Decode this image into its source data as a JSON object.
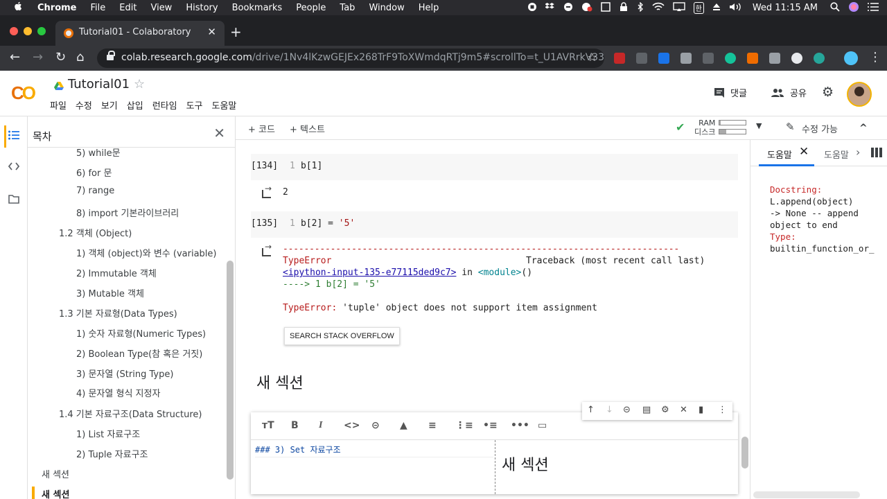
{
  "menubar": {
    "apple": "",
    "app": "Chrome",
    "items": [
      "File",
      "Edit",
      "View",
      "History",
      "Bookmarks",
      "People",
      "Tab",
      "Window",
      "Help"
    ],
    "ime": "한",
    "clock": "Wed 11:15 AM"
  },
  "browser": {
    "tab_title": "Tutorial01 - Colaboratory",
    "tab_close": "✕",
    "new_tab": "+",
    "url_host": "colab.research.google.com",
    "url_path": "/drive/1Nv4lKzwGEJEx268TrF9ToXWmdqRTj9m5#scrollTo=t_U1AVRrkV33",
    "back": "←",
    "forward": "→",
    "reload": "↻",
    "home": "⌂",
    "bookmark_star": "☆"
  },
  "colab": {
    "logo": "CO",
    "title": "Tutorial01",
    "title_star": "☆",
    "menus": [
      "파일",
      "수정",
      "보기",
      "삽입",
      "런타임",
      "도구",
      "도움말"
    ],
    "comment_label": "댓글",
    "share_label": "공유",
    "settings_glyph": "⚙"
  },
  "toc": {
    "header": "목차",
    "close": "✕",
    "items": [
      "5) while문",
      "6) for 문",
      "7) range",
      "8) import 기본라이브러리",
      "1.2 객체 (Object)",
      "1) 객체 (object)와 변수 (variable)",
      "2) Immutable 객체",
      "3) Mutable 객체",
      "1.3 기본 자료형(Data Types)",
      "1) 숫자 자료형(Numeric Types)",
      "2) Boolean Type(참 혹은 거짓)",
      "3) 문자열 (String Type)",
      "4) 문자열 형식 지정자",
      "1.4 기본 자료구조(Data Structure)",
      "1) List 자료구조",
      "2) Tuple 자료구조",
      "새 섹션",
      "새 섹션"
    ]
  },
  "notebook_toolbar": {
    "add_code": "+ 코드",
    "add_text": "+ 텍스트",
    "ram_label": "RAM",
    "disk_label": "디스크",
    "ram_usage": 0.05,
    "disk_usage": 0.25,
    "edit_mode": "수정 가능",
    "collapse": "^"
  },
  "cells": {
    "c134": {
      "prompt": "[134]",
      "line": "1",
      "code": "b[1]",
      "output": "2"
    },
    "c135": {
      "prompt": "[135]",
      "line": "1",
      "code_pre": "b[2] = ",
      "code_str": "'5'",
      "error_rule": "---------------------------------------------------------------------------",
      "error_type": "TypeError",
      "error_trace_label": "Traceback (most recent call last)",
      "error_link": "<ipython-input-135-e77115ded9c7>",
      "error_in": " in ",
      "error_module": "<module>",
      "error_paren": "()",
      "error_arrow": "----> 1 b[2] = '5'",
      "error_msg_type": "TypeError:",
      "error_msg": " 'tuple' object does not support item assignment",
      "so_button": "SEARCH STACK OVERFLOW"
    },
    "section_heading": "새 섹션",
    "text_cell_source": "### 3) Set 자료구조",
    "text_cell_preview": "새 섹션"
  },
  "help_panel": {
    "tab1": "도움말",
    "tab1_close": "✕",
    "tab2": "도움말",
    "chevron": "›",
    "docstring_label": "Docstring:",
    "docstring_lines": "L.append(object)\n-> None -- append\nobject to end",
    "type_label": "Type:",
    "type_value": "builtin_function_or_"
  }
}
